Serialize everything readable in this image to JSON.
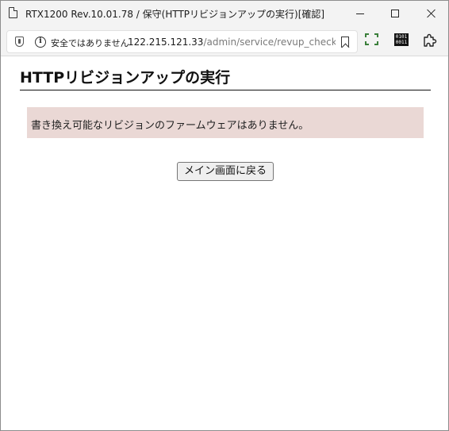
{
  "window": {
    "title": "RTX1200 Rev.10.01.78 / 保守(HTTPリビジョンアップの実行)[確認]"
  },
  "addressbar": {
    "security_label": "安全ではありません",
    "url_host": "122.215.121.33",
    "url_path": "/admin/service/revup_check...."
  },
  "toolbar": {
    "binary_icon_text": "0101 0011"
  },
  "page": {
    "title": "HTTPリビジョンアップの実行",
    "message": "書き換え可能なリビジョンのファームウェアはありません。",
    "back_button_label": "メイン画面に戻る"
  },
  "colors": {
    "message_background": "#ead8d5",
    "chrome_background": "#f3f3f3"
  }
}
